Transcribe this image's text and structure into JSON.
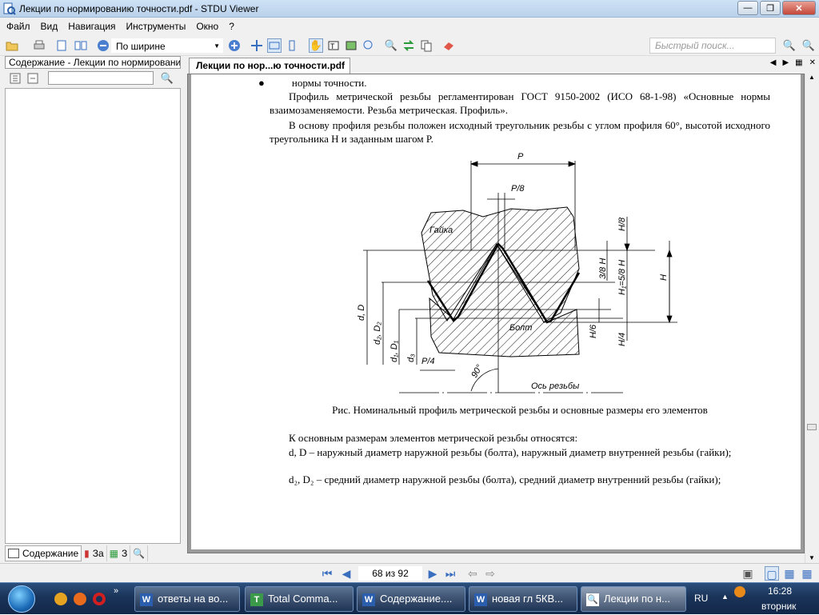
{
  "window": {
    "title": "Лекции по нормированию точности.pdf - STDU Viewer"
  },
  "menu": {
    "file": "Файл",
    "view": "Вид",
    "nav": "Навигация",
    "tools": "Инструменты",
    "window": "Окно",
    "help": "?"
  },
  "toolbar": {
    "zoom": "По ширине",
    "search_placeholder": "Быстрый поиск..."
  },
  "left_pane": {
    "title": "Содержание - Лекции по нормированию точности.pdf",
    "tabs": [
      "Содержание",
      "За",
      "З"
    ]
  },
  "doc": {
    "tab": "Лекции по нор...ю точности.pdf",
    "bullet_line": "нормы точности.",
    "para1": "Профиль метрической резьбы регламентирован ГОСТ 9150-2002 (ИСО 68-1-98) «Основные нормы взаимозаменяемости. Резьба метрическая. Профиль».",
    "para2": "В основу профиля резьбы положен исходный треугольник резьбы с углом профиля 60°, высотой исходного треугольника H и заданным шагом P.",
    "figure": {
      "caption": "Рис. Номинальный профиль метрической резьбы и основные размеры его элементов",
      "nut": "Гайка",
      "bolt": "Болт",
      "axis": "Ось резьбы",
      "P": "P",
      "P8": "P/8",
      "P4": "P/4",
      "H8": "H/8",
      "H38": "3/8 H",
      "H158": "H₁=5/8 H",
      "H": "H",
      "H6": "H/6",
      "H4": "H/4",
      "dD": "d, D",
      "d2D2": "d₂, D₂",
      "d1D1": "d₁, D₁",
      "d3": "d₃",
      "angle": "90°"
    },
    "para3": "К основным размерам элементов метрической резьбы относятся:",
    "para4": "d, D – наружный диаметр наружной резьбы (болта), наружный диаметр внутренней резьбы (гайки);",
    "para5": "d₂, D₂ – средний диаметр наружной резьбы (болта), средний диаметр внутренний резьбы (гайки);"
  },
  "status": {
    "page": "68 из 92"
  },
  "taskbar": {
    "items": [
      "ответы на во...",
      "Total Comma...",
      "Содержание....",
      "новая гл 5КВ...",
      "Лекции по н..."
    ],
    "lang": "RU",
    "time": "16:28",
    "day": "вторник"
  }
}
